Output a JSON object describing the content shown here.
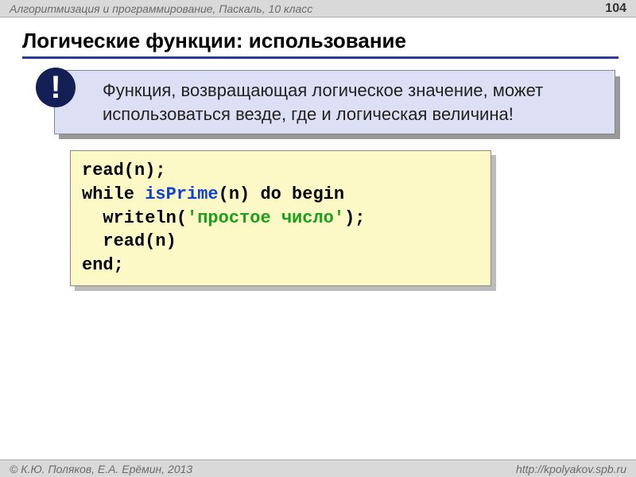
{
  "header": {
    "course": "Алгоритмизация и программирование, Паскаль, 10 класс",
    "page": "104"
  },
  "title": "Логические функции: использование",
  "callout": {
    "bang": "!",
    "text": "Функция, возвращающая логическое значение, может использоваться везде, где и логическая величина!"
  },
  "code": {
    "l1": "read(n);",
    "l2a": "while ",
    "l2b": "isPrime",
    "l2c": "(n) do begin",
    "l3a": "  writeln(",
    "l3b": "'простое число'",
    "l3c": ");",
    "l4": "  read(n)",
    "l5": "end;"
  },
  "footer": {
    "authors": "© К.Ю. Поляков, Е.А. Ерёмин, 2013",
    "url": "http://kpolyakov.spb.ru"
  }
}
